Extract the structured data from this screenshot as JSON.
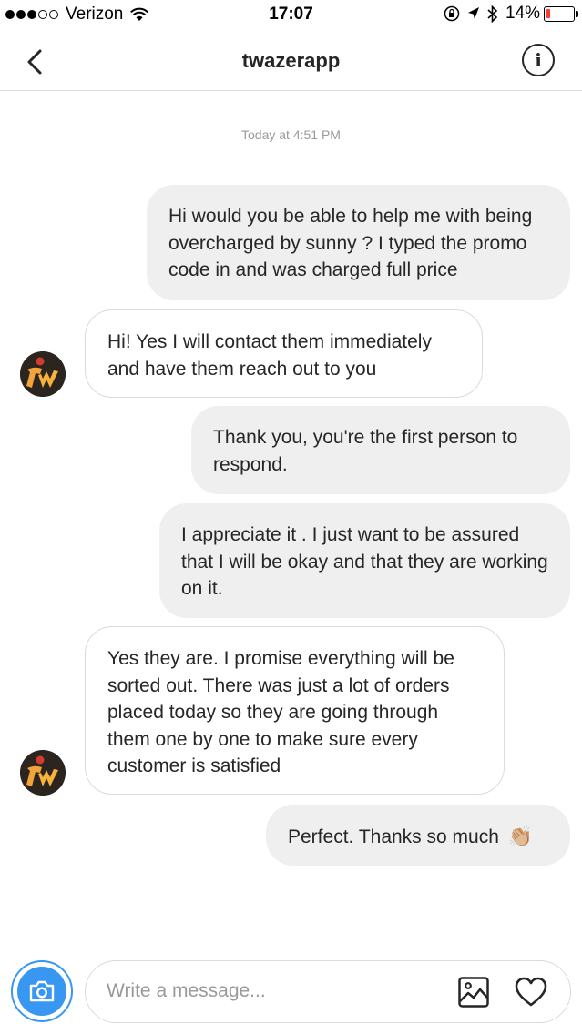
{
  "status_bar": {
    "carrier": "Verizon",
    "time": "17:07",
    "battery_percent_label": "14%",
    "battery_level": 0.14,
    "signal_bars_filled": 3,
    "signal_bars_total": 5
  },
  "nav": {
    "title": "twazerapp",
    "info_label": "i"
  },
  "thread": {
    "timestamp": "Today at 4:51 PM",
    "messages": [
      {
        "direction": "outgoing",
        "text": "Hi would you be able to help me with being overcharged by sunny ? I typed the promo code in and was charged full price"
      },
      {
        "direction": "incoming",
        "text": "Hi! Yes I will contact them immediately and have them reach out to you"
      },
      {
        "direction": "outgoing",
        "text": "Thank you, you're the first person to respond."
      },
      {
        "direction": "outgoing",
        "text": "I appreciate it . I just want to be assured that I will be okay and that they are working on it."
      },
      {
        "direction": "incoming",
        "text": "Yes they are. I promise everything will be sorted out. There was just a lot of orders placed today so they are going through them one by one to make sure every customer is satisfied"
      },
      {
        "direction": "outgoing",
        "text": "Perfect. Thanks so much",
        "emoji": "👏🏼"
      }
    ]
  },
  "composer": {
    "placeholder": "Write a message..."
  },
  "colors": {
    "accent": "#3897f0",
    "outgoing_bubble": "#efefef",
    "border": "#dbdbdb",
    "battery_low": "#ff3b30"
  },
  "icons": {
    "back": "chevron-left-icon",
    "info": "info-icon",
    "camera": "camera-icon",
    "gallery": "image-icon",
    "like": "heart-icon"
  }
}
